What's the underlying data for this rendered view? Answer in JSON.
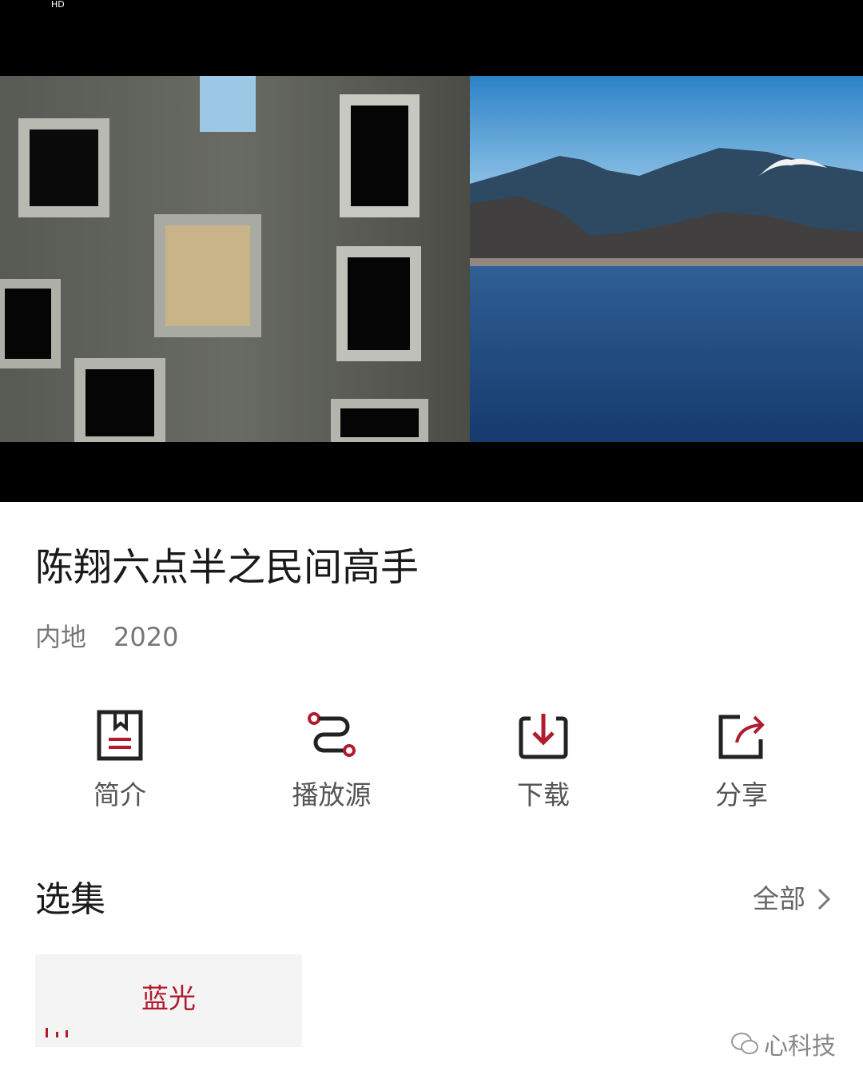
{
  "video": {
    "status_icon": "HD"
  },
  "show": {
    "title": "陈翔六点半之民间高手",
    "region": "内地",
    "year": "2020"
  },
  "actions": [
    {
      "label": "简介",
      "icon": "intro-icon"
    },
    {
      "label": "播放源",
      "icon": "source-icon"
    },
    {
      "label": "下载",
      "icon": "download-icon"
    },
    {
      "label": "分享",
      "icon": "share-icon"
    }
  ],
  "episodes_section": {
    "title": "选集",
    "all_label": "全部",
    "items": [
      {
        "label": "蓝光",
        "playing": true
      }
    ]
  },
  "watermark": {
    "text": "心科技"
  },
  "colors": {
    "accent": "#b01c2e",
    "icon_dark": "#222222"
  }
}
